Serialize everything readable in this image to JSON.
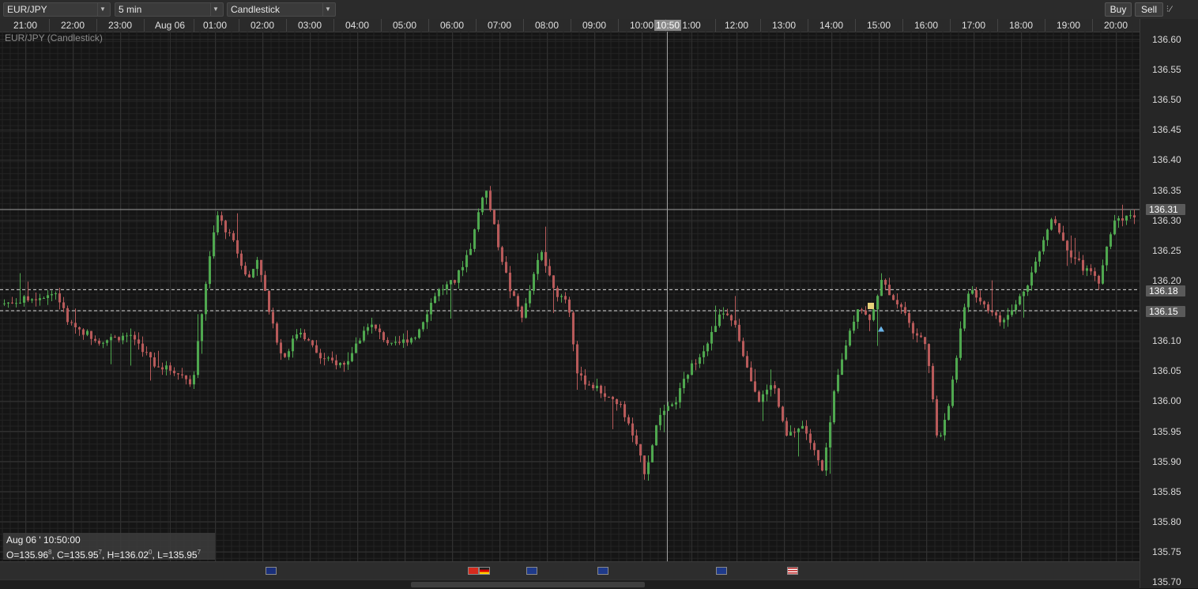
{
  "toolbar": {
    "symbol": "EUR/JPY",
    "interval": "5 min",
    "chart_type": "Candlestick",
    "buy_label": "Buy",
    "sell_label": "Sell"
  },
  "chart_title": "EUR/JPY (Candlestick)",
  "time_axis": {
    "labels": [
      "21:00",
      "22:00",
      "23:00",
      "Aug 06",
      "01:00",
      "02:00",
      "03:00",
      "04:00",
      "05:00",
      "06:00",
      "07:00",
      "08:00",
      "09:00",
      "10:00",
      "1:00",
      "12:00",
      "13:00",
      "14:00",
      "15:00",
      "16:00",
      "17:00",
      "18:00",
      "19:00",
      "20:00"
    ],
    "cursor_time": "10:50"
  },
  "price_axis": {
    "labels": [
      "136.60",
      "136.55",
      "136.50",
      "136.45",
      "136.40",
      "136.35",
      "136.30",
      "136.25",
      "136.20",
      "136.15",
      "136.10",
      "136.05",
      "136.00",
      "135.95",
      "135.90",
      "135.85",
      "135.80",
      "135.75",
      "135.70"
    ],
    "current_price": "136.31",
    "line_upper": "136.18",
    "line_lower": "136.15"
  },
  "ohlc_info": {
    "date": "Aug 06 ' 10:50:00",
    "o": "O=135.96",
    "o_sup": "8",
    "c": ", C=135.95",
    "c_sup": "7",
    "h": ", H=136.02",
    "h_sup": "0",
    "l": ", L=135.95",
    "l_sup": "7"
  },
  "colors": {
    "up": "#4fa84f",
    "down": "#b85a5a",
    "background": "#151515"
  },
  "events": [
    {
      "name": "australia-flag-icon"
    },
    {
      "name": "switzerland-flag-icon"
    },
    {
      "name": "germany-flag-icon"
    },
    {
      "name": "uk-flag-icon"
    },
    {
      "name": "uk-flag-icon"
    },
    {
      "name": "uk-flag-icon"
    },
    {
      "name": "usa-flag-icon"
    }
  ],
  "chart_data": {
    "type": "candlestick",
    "symbol": "EUR/JPY",
    "ylim": [
      135.72,
      136.62
    ],
    "anchors": [
      [
        0,
        136.16
      ],
      [
        40,
        136.17
      ],
      [
        75,
        136.18
      ],
      [
        90,
        136.13
      ],
      [
        130,
        136.1
      ],
      [
        170,
        136.11
      ],
      [
        200,
        136.06
      ],
      [
        225,
        136.05
      ],
      [
        248,
        136.03
      ],
      [
        262,
        136.18
      ],
      [
        278,
        136.31
      ],
      [
        300,
        136.26
      ],
      [
        318,
        136.2
      ],
      [
        330,
        136.24
      ],
      [
        345,
        136.14
      ],
      [
        362,
        136.07
      ],
      [
        382,
        136.12
      ],
      [
        410,
        136.07
      ],
      [
        440,
        136.06
      ],
      [
        470,
        136.13
      ],
      [
        500,
        136.09
      ],
      [
        530,
        136.11
      ],
      [
        555,
        136.18
      ],
      [
        580,
        136.2
      ],
      [
        600,
        136.26
      ],
      [
        617,
        136.36
      ],
      [
        632,
        136.27
      ],
      [
        650,
        136.18
      ],
      [
        665,
        136.14
      ],
      [
        688,
        136.25
      ],
      [
        705,
        136.18
      ],
      [
        722,
        136.17
      ],
      [
        735,
        136.04
      ],
      [
        760,
        136.02
      ],
      [
        790,
        135.99
      ],
      [
        805,
        135.94
      ],
      [
        820,
        135.88
      ],
      [
        838,
        135.98
      ],
      [
        855,
        135.99
      ],
      [
        875,
        136.05
      ],
      [
        900,
        136.1
      ],
      [
        918,
        136.15
      ],
      [
        935,
        136.12
      ],
      [
        950,
        136.05
      ],
      [
        965,
        136.0
      ],
      [
        982,
        136.03
      ],
      [
        998,
        135.94
      ],
      [
        1020,
        135.96
      ],
      [
        1045,
        135.88
      ],
      [
        1060,
        136.02
      ],
      [
        1075,
        136.1
      ],
      [
        1090,
        136.16
      ],
      [
        1105,
        136.13
      ],
      [
        1118,
        136.2
      ],
      [
        1135,
        136.17
      ],
      [
        1148,
        136.15
      ],
      [
        1160,
        136.11
      ],
      [
        1175,
        136.1
      ],
      [
        1190,
        135.93
      ],
      [
        1205,
        136.0
      ],
      [
        1218,
        136.11
      ],
      [
        1230,
        136.19
      ],
      [
        1250,
        136.16
      ],
      [
        1270,
        136.13
      ],
      [
        1285,
        136.15
      ],
      [
        1305,
        136.2
      ],
      [
        1320,
        136.25
      ],
      [
        1335,
        136.31
      ],
      [
        1355,
        136.25
      ],
      [
        1375,
        136.22
      ],
      [
        1395,
        136.2
      ],
      [
        1412,
        136.3
      ],
      [
        1438,
        136.31
      ]
    ]
  }
}
